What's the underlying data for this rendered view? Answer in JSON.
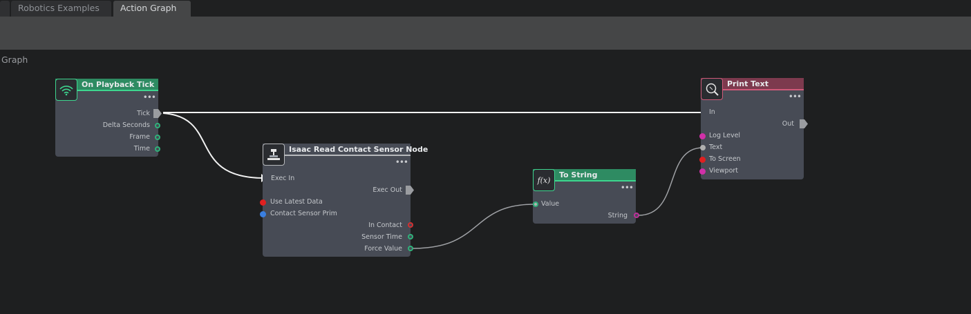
{
  "tabs": [
    {
      "label": ""
    },
    {
      "label": "Robotics Examples"
    },
    {
      "label": "Action Graph"
    }
  ],
  "graph": {
    "label": "Graph"
  },
  "nodes": {
    "playback": {
      "title": "On Playback Tick",
      "color": "#2e8b62",
      "menu": "•••",
      "ports": {
        "tick": "Tick",
        "delta": "Delta Seconds",
        "frame": "Frame",
        "time": "Time"
      }
    },
    "sensor": {
      "title": "Isaac Read Contact Sensor Node",
      "color": "#7a7c80",
      "menu": "•••",
      "ports": {
        "exec_in": "Exec In",
        "exec_out": "Exec Out",
        "use_latest": "Use Latest Data",
        "prim": "Contact Sensor Prim",
        "in_contact": "In Contact",
        "sensor_time": "Sensor Time",
        "force": "Force Value"
      }
    },
    "tostring": {
      "title": "To String",
      "color": "#2e8b62",
      "menu": "•••",
      "icon_text": "f(x)",
      "ports": {
        "value": "Value",
        "string": "String"
      }
    },
    "print": {
      "title": "Print Text",
      "color": "#7d3a4e",
      "menu": "•••",
      "ports": {
        "in": "In",
        "out": "Out",
        "log_level": "Log Level",
        "text": "Text",
        "to_screen": "To Screen",
        "viewport": "Viewport"
      }
    }
  }
}
